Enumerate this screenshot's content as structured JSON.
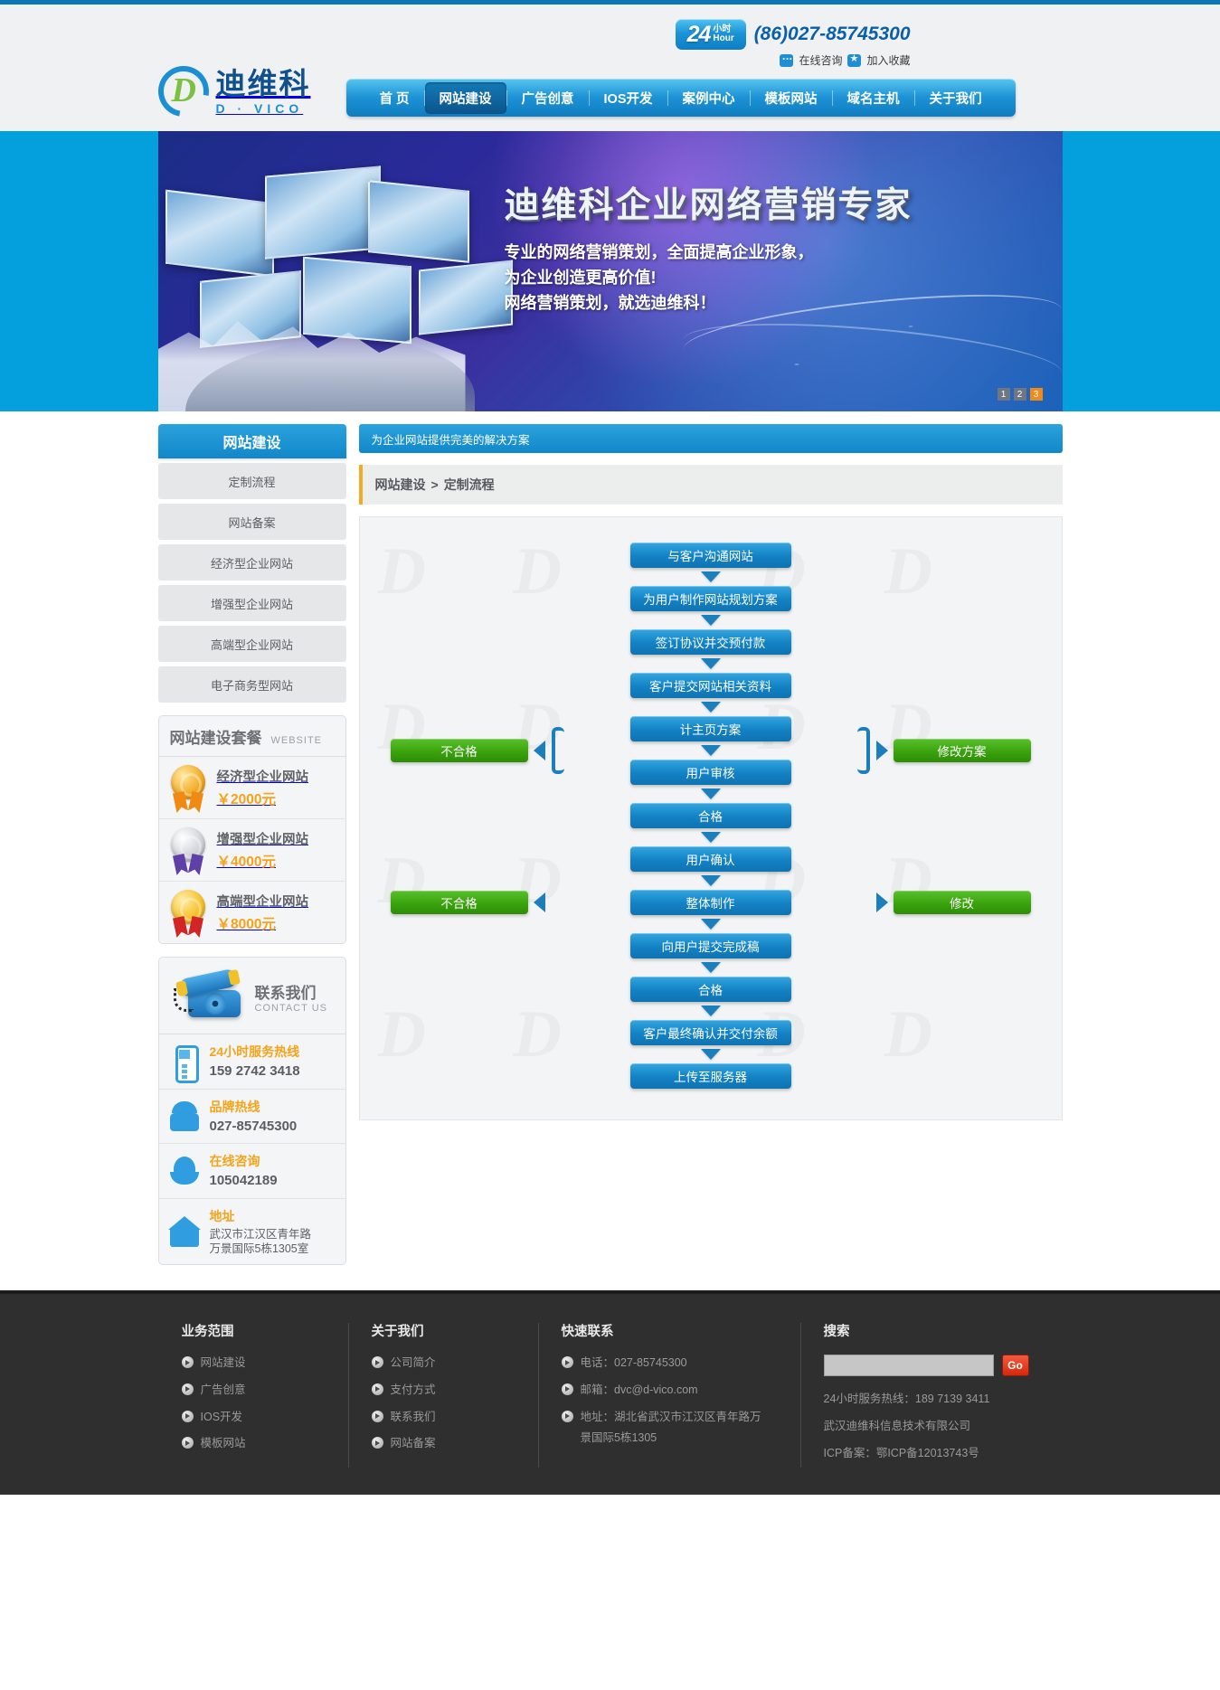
{
  "header": {
    "hour_badge": {
      "number": "24",
      "cn": "小时",
      "en": "Hour"
    },
    "phone": "(86)027-85745300",
    "links": [
      {
        "name": "online-consult",
        "label": "在线咨询",
        "icon": "chat-icon"
      },
      {
        "name": "add-favorite",
        "label": "加入收藏",
        "icon": "star-icon"
      }
    ],
    "logo": {
      "cn": "迪维科",
      "en": "D · VICO",
      "mark": "D"
    },
    "nav": [
      {
        "label": "首 页",
        "active": false
      },
      {
        "label": "网站建设",
        "active": true
      },
      {
        "label": "广告创意",
        "active": false
      },
      {
        "label": "IOS开发",
        "active": false
      },
      {
        "label": "案例中心",
        "active": false
      },
      {
        "label": "模板网站",
        "active": false
      },
      {
        "label": "域名主机",
        "active": false
      },
      {
        "label": "关于我们",
        "active": false
      }
    ]
  },
  "banner": {
    "title": "迪维科企业网络营销专家",
    "lines": [
      "专业的网络营销策划，全面提高企业形象，",
      "为企业创造更高价值!",
      "网络营销策划，就选迪维科！"
    ],
    "dots": [
      "1",
      "2",
      "3"
    ],
    "active_dot": 3
  },
  "sidebar": {
    "title": "网站建设",
    "items": [
      {
        "label": "定制流程"
      },
      {
        "label": "网站备案"
      },
      {
        "label": "经济型企业网站"
      },
      {
        "label": "增强型企业网站"
      },
      {
        "label": "高端型企业网站"
      },
      {
        "label": "电子商务型网站"
      }
    ],
    "packages": {
      "title_cn": "网站建设套餐",
      "title_en": "WEBSITE",
      "rows": [
        {
          "medal": "gold",
          "name": "经济型企业网站",
          "price": "￥2000元"
        },
        {
          "medal": "silver",
          "name": "增强型企业网站",
          "price": "￥4000元"
        },
        {
          "medal": "gold1",
          "name": "高端型企业网站",
          "price": "￥8000元"
        }
      ]
    },
    "contact": {
      "title_cn": "联系我们",
      "title_en": "CONTACT US",
      "rows": [
        {
          "icon": "mobile-icon",
          "label": "24小时服务热线",
          "value": "159 2742 3418",
          "small": false
        },
        {
          "icon": "telephone-icon",
          "label": "品牌热线",
          "value": "027-85745300",
          "small": false
        },
        {
          "icon": "qq-icon",
          "label": "在线咨询",
          "value": "105042189",
          "small": false
        },
        {
          "icon": "home-icon",
          "label": "地址",
          "value": "武汉市江汉区青年路\n万景国际5栋1305室",
          "small": true
        }
      ]
    }
  },
  "content": {
    "subtitle": "为企业网站提供完美的解决方案",
    "breadcrumb": {
      "parent": "网站建设",
      "sep": ">",
      "current": "定制流程"
    },
    "watermark": "D",
    "flow": {
      "steps": [
        {
          "type": "box",
          "label": "与客户沟通网站"
        },
        {
          "type": "arrow"
        },
        {
          "type": "box",
          "label": "为用户制作网站规划方案"
        },
        {
          "type": "arrow"
        },
        {
          "type": "box",
          "label": "签订协议并交预付款"
        },
        {
          "type": "arrow"
        },
        {
          "type": "box",
          "label": "客户提交网站相关资料"
        },
        {
          "type": "arrow"
        },
        {
          "type": "branch",
          "top": "计主页方案",
          "bottom": "用户审核",
          "left": "不合格",
          "right": "修改方案"
        },
        {
          "type": "arrow"
        },
        {
          "type": "box",
          "label": "合格"
        },
        {
          "type": "arrow"
        },
        {
          "type": "box",
          "label": "用户确认"
        },
        {
          "type": "arrow"
        },
        {
          "type": "branch2",
          "center": "整体制作",
          "left": "不合格",
          "right": "修改"
        },
        {
          "type": "arrow"
        },
        {
          "type": "box",
          "label": "向用户提交完成稿"
        },
        {
          "type": "arrow"
        },
        {
          "type": "box",
          "label": "合格"
        },
        {
          "type": "arrow"
        },
        {
          "type": "box",
          "label": "客户最终确认并交付余额"
        },
        {
          "type": "arrow"
        },
        {
          "type": "box",
          "label": "上传至服务器"
        }
      ]
    }
  },
  "footer": {
    "col1": {
      "title": "业务范围",
      "items": [
        "网站建设",
        "广告创意",
        "IOS开发",
        "模板网站"
      ]
    },
    "col2": {
      "title": "关于我们",
      "items": [
        "公司简介",
        "支付方式",
        "联系我们",
        "网站备案"
      ]
    },
    "col3": {
      "title": "快速联系",
      "items": [
        {
          "text": "电话：027-85745300",
          "text2": ""
        },
        {
          "text": "邮箱：dvc@d-vico.com",
          "text2": ""
        },
        {
          "text": "地址：湖北省武汉市江汉区青年路万",
          "text2": "景国际5栋1305"
        }
      ]
    },
    "col4": {
      "title": "搜索",
      "search_value": "",
      "search_placeholder": "",
      "go_label": "Go",
      "notes": [
        "24小时服务热线：189 7139 3411",
        "武汉迪维科信息技术有限公司",
        "ICP备案：鄂ICP备12013743号"
      ]
    }
  }
}
